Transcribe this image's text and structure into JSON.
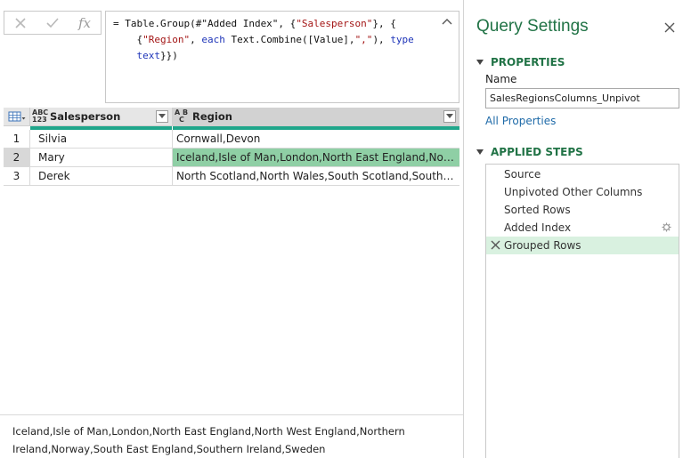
{
  "formula": {
    "cancel_icon": "close-icon",
    "commit_icon": "check-icon",
    "fx_label": "fx",
    "line1": {
      "a": "= Table.Group(#\"Added Index\", {",
      "b": "\"Salesperson\"",
      "c": "}, {"
    },
    "line2": {
      "a": "{",
      "b": "\"Region\"",
      "c": ", ",
      "d": "each",
      "e": " Text.Combine([Value],",
      "f": "\",\"",
      "g": "), ",
      "h": "type"
    },
    "line3": {
      "a": "text",
      "b": "}})"
    }
  },
  "grid": {
    "columns": [
      {
        "type_top": "ABC",
        "type_bottom": "123",
        "title": "Salesperson"
      },
      {
        "type_top": "A B",
        "type_bottom": "C",
        "title": "Region"
      }
    ],
    "rows": [
      {
        "index": "1",
        "salesperson": "Silvia",
        "region": "Cornwall,Devon"
      },
      {
        "index": "2",
        "salesperson": "Mary",
        "region": "Iceland,Isle of Man,London,North East England,North West England,Northern Ireland,Norway,South East England,Southern Ireland,Sweden"
      },
      {
        "index": "3",
        "salesperson": "Derek",
        "region": "North Scotland,North Wales,South Scotland,South Wales"
      }
    ],
    "selected_row": 2,
    "colors": {
      "header_bg": "#e6e6e6",
      "quality_bar": "#1fa68b",
      "selected_cell": "#8fcfa5"
    }
  },
  "preview": {
    "line1": "Iceland,Isle of Man,London,North East England,North West England,Northern",
    "line2": "Ireland,Norway,South East England,Southern Ireland,Sweden"
  },
  "query_settings": {
    "title": "Query Settings",
    "properties_header": "PROPERTIES",
    "name_label": "Name",
    "name_value": "SalesRegionsColumns_Unpivot",
    "all_properties_link": "All Properties",
    "applied_steps_header": "APPLIED STEPS",
    "steps": [
      {
        "label": "Source"
      },
      {
        "label": "Unpivoted Other Columns"
      },
      {
        "label": "Sorted Rows"
      },
      {
        "label": "Added Index",
        "has_gear": true
      },
      {
        "label": "Grouped Rows",
        "selected": true
      }
    ],
    "accent_color": "#217346"
  }
}
